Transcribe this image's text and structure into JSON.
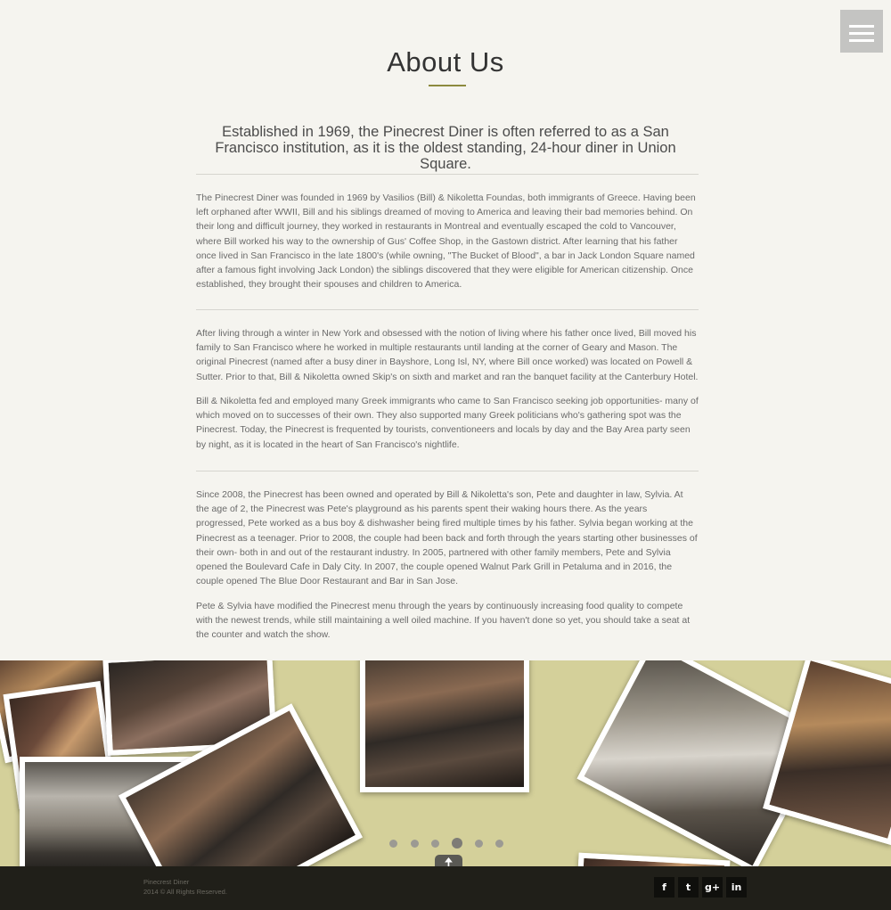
{
  "header": {
    "menu_icon": "hamburger-icon"
  },
  "about": {
    "title": "About Us",
    "lead": "Established in 1969, the Pinecrest Diner is often referred to as a San Francisco institution, as it is the oldest standing, 24-hour diner in Union Square.",
    "paragraphs": [
      "The Pinecrest Diner was founded in 1969 by Vasilios (Bill) & Nikoletta Foundas, both immigrants of Greece. Having been left orphaned after WWII, Bill and his siblings dreamed of moving to America and leaving their bad memories behind. On their long and difficult journey, they worked in restaurants in Montreal and eventually escaped the cold to Vancouver, where Bill worked his way to the ownership of Gus' Coffee Shop, in the Gastown district. After learning that his father once lived in San Francisco in the late 1800's (while owning, \"The Bucket of Blood\", a bar in Jack London Square named after a famous fight involving Jack London) the siblings discovered that they were eligible for American citizenship. Once established, they brought their spouses and children to America.",
      "After living through a winter in New York and obsessed with the notion of living where his father once lived, Bill moved his family to San Francisco where he worked in multiple restaurants until landing at the corner of Geary and Mason. The original Pinecrest (named after a busy diner in Bayshore, Long Isl, NY, where Bill once worked) was located on Powell & Sutter. Prior to that, Bill & Nikoletta owned Skip's on sixth and market and ran the banquet facility at the Canterbury Hotel.",
      "Bill & Nikoletta fed and employed many Greek immigrants who came to San Francisco seeking job opportunities- many of which moved on to successes of their own. They also supported many Greek politicians who's gathering spot was the Pinecrest. Today, the Pinecrest is frequented by tourists, conventioneers and locals by day and the Bay Area party seen by night, as it is located in the heart of San Francisco's nightlife.",
      "Since 2008, the Pinecrest has been owned and operated by Bill & Nikoletta's son, Pete and daughter in law, Sylvia. At the age of 2, the Pinecrest was Pete's playground as his parents spent their waking hours there. As the years progressed, Pete worked as a bus boy & dishwasher being fired multiple times by his father. Sylvia began working at the Pinecrest as a teenager. Prior to 2008, the couple had been back and forth through the years starting other businesses of their own- both in and out of the restaurant industry. In 2005, partnered with other family members, Pete and Sylvia opened the Boulevard Cafe in Daly City. In 2007, the couple opened Walnut Park Grill in Petaluma and in 2016, the couple opened The Blue Door Restaurant and Bar in San Jose.",
      "Pete & Sylvia have modified the Pinecrest menu through the years by continuously increasing food quality to compete with the newest trends, while still maintaining a well oiled machine. If you haven't done so yet, you should take a seat at the counter and watch the show."
    ]
  },
  "gallery": {
    "slide_count": 6,
    "active_slide": 4,
    "back_to_top_icon": "arrow-up-icon"
  },
  "footer": {
    "name": "Pinecrest Diner",
    "copyright": "2014 © All Rights Reserved.",
    "social": [
      {
        "icon": "facebook-icon",
        "glyph": "f"
      },
      {
        "icon": "twitter-icon",
        "glyph": "t"
      },
      {
        "icon": "google-plus-icon",
        "glyph": "g+"
      },
      {
        "icon": "linkedin-icon",
        "glyph": "in"
      }
    ]
  }
}
